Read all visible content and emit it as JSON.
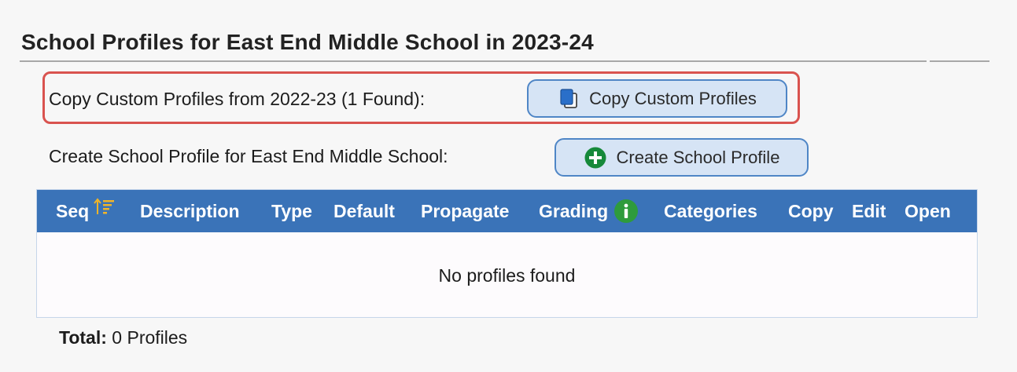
{
  "header": {
    "title": "School Profiles for East End Middle School in 2023-24"
  },
  "copy_row": {
    "label": "Copy Custom Profiles from 2022-23 (1 Found):",
    "button_label": "Copy Custom Profiles",
    "button_icon": "copy-icon"
  },
  "create_row": {
    "label": "Create School Profile for East End Middle School:",
    "button_label": "Create School Profile",
    "button_icon": "plus-circle-icon"
  },
  "table": {
    "columns": [
      "Seq",
      "Description",
      "Type",
      "Default",
      "Propagate",
      "Grading",
      "Categories",
      "Copy",
      "Edit",
      "Open"
    ],
    "sort_icon": "sort-ascending-icon",
    "info_icon": "info-icon",
    "empty_message": "No profiles found",
    "rows": []
  },
  "footer": {
    "total_label": "Total:",
    "total_value": "0 Profiles"
  },
  "colors": {
    "header_bg": "#3a73b8",
    "button_bg": "#d6e4f5",
    "button_border": "#4f86c6",
    "highlight": "#d9534f",
    "info_green": "#2e9b3c",
    "sort_gold": "#f0b429"
  }
}
